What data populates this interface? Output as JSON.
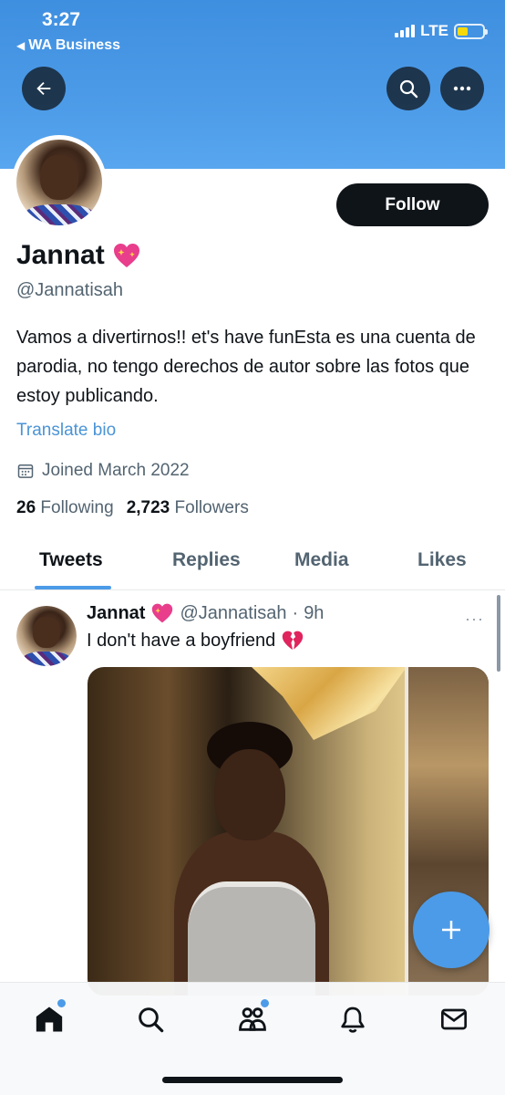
{
  "status_bar": {
    "time": "3:27",
    "back_app": "WA Business",
    "network": "LTE"
  },
  "header": {
    "back_icon": "arrow-left-icon",
    "search_icon": "search-icon",
    "more_icon": "more-horizontal-icon"
  },
  "profile": {
    "follow_label": "Follow",
    "display_name": "Jannat",
    "name_emoji": "sparkling-heart",
    "handle": "@Jannatisah",
    "bio": "Vamos a divertirnos!! et's have funEsta es una cuenta de parodia, no tengo derechos de autor sobre las fotos que estoy publicando.",
    "translate_label": "Translate bio",
    "joined": "Joined March 2022",
    "following_count": "26",
    "following_label": "Following",
    "followers_count": "2,723",
    "followers_label": "Followers"
  },
  "tabs": [
    {
      "label": "Tweets",
      "active": true
    },
    {
      "label": "Replies",
      "active": false
    },
    {
      "label": "Media",
      "active": false
    },
    {
      "label": "Likes",
      "active": false
    }
  ],
  "tweet": {
    "name": "Jannat",
    "handle": "@Jannatisah",
    "separator": "·",
    "time": "9h",
    "more": "···",
    "text": "I don't have a boyfriend",
    "text_emoji": "broken-heart"
  },
  "colors": {
    "accent": "#4c9be8",
    "banner": "#4c9be8",
    "text_primary": "#0f1419",
    "text_secondary": "#536471"
  },
  "bottom_nav": [
    {
      "icon": "home-icon",
      "badge": true
    },
    {
      "icon": "search-icon",
      "badge": false
    },
    {
      "icon": "communities-icon",
      "badge": true
    },
    {
      "icon": "notifications-bell-icon",
      "badge": false
    },
    {
      "icon": "messages-envelope-icon",
      "badge": false
    }
  ]
}
